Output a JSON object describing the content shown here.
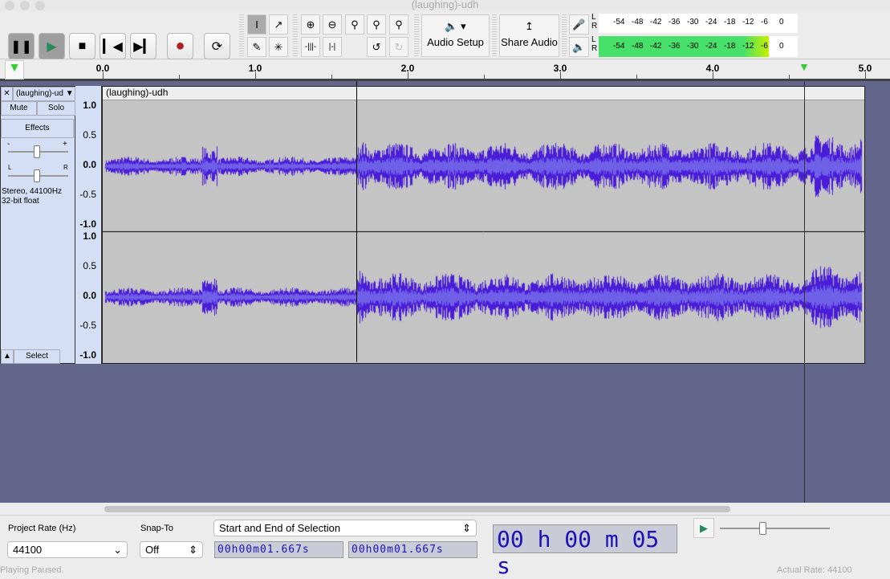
{
  "window": {
    "title": "(laughing)-udh"
  },
  "transport": {
    "pause": "pause-icon",
    "play": "play-icon",
    "stop": "stop-icon",
    "skip_start": "skip-start-icon",
    "skip_end": "skip-end-icon",
    "record": "record-icon",
    "loop": "loop-icon"
  },
  "tools": {
    "audio_setup": "Audio Setup",
    "share_audio": "Share Audio"
  },
  "meters": {
    "rec_ticks": [
      "-54",
      "-48",
      "-42",
      "-36",
      "-30",
      "-24",
      "-18",
      "-12",
      "-6",
      "0"
    ],
    "play_ticks": [
      "-54",
      "-48",
      "-42",
      "-36",
      "-30",
      "-24",
      "-18",
      "-12",
      "-6",
      "0"
    ],
    "L": "L",
    "R": "R",
    "playback_level_db": -8
  },
  "ruler": {
    "labels": [
      "0.0",
      "1.0",
      "2.0",
      "3.0",
      "4.0",
      "5.0"
    ],
    "selection_s": 1.667,
    "playhead_s": 4.6
  },
  "track": {
    "name": "(laughing)-ud",
    "clip_name": "(laughing)-udh",
    "mute": "Mute",
    "solo": "Solo",
    "effects": "Effects",
    "minus": "-",
    "plus": "+",
    "pan_l": "L",
    "pan_r": "R",
    "info1": "Stereo, 44100Hz",
    "info2": "32-bit float",
    "select": "Select",
    "scale": [
      "1.0",
      "0.5",
      "0.0",
      "-0.5",
      "-1.0"
    ],
    "wave_color": "#4a1ed8"
  },
  "bottom": {
    "project_rate_label": "Project Rate (Hz)",
    "project_rate": "44100",
    "snap_label": "Snap-To",
    "snap": "Off",
    "selection_mode": "Start and End of Selection",
    "sel_start": "00h00m01.667s",
    "sel_end": "00h00m01.667s",
    "time": "00 h 00 m 05 s"
  },
  "status": {
    "left": "Playing Paused.",
    "right": "Actual Rate: 44100"
  }
}
